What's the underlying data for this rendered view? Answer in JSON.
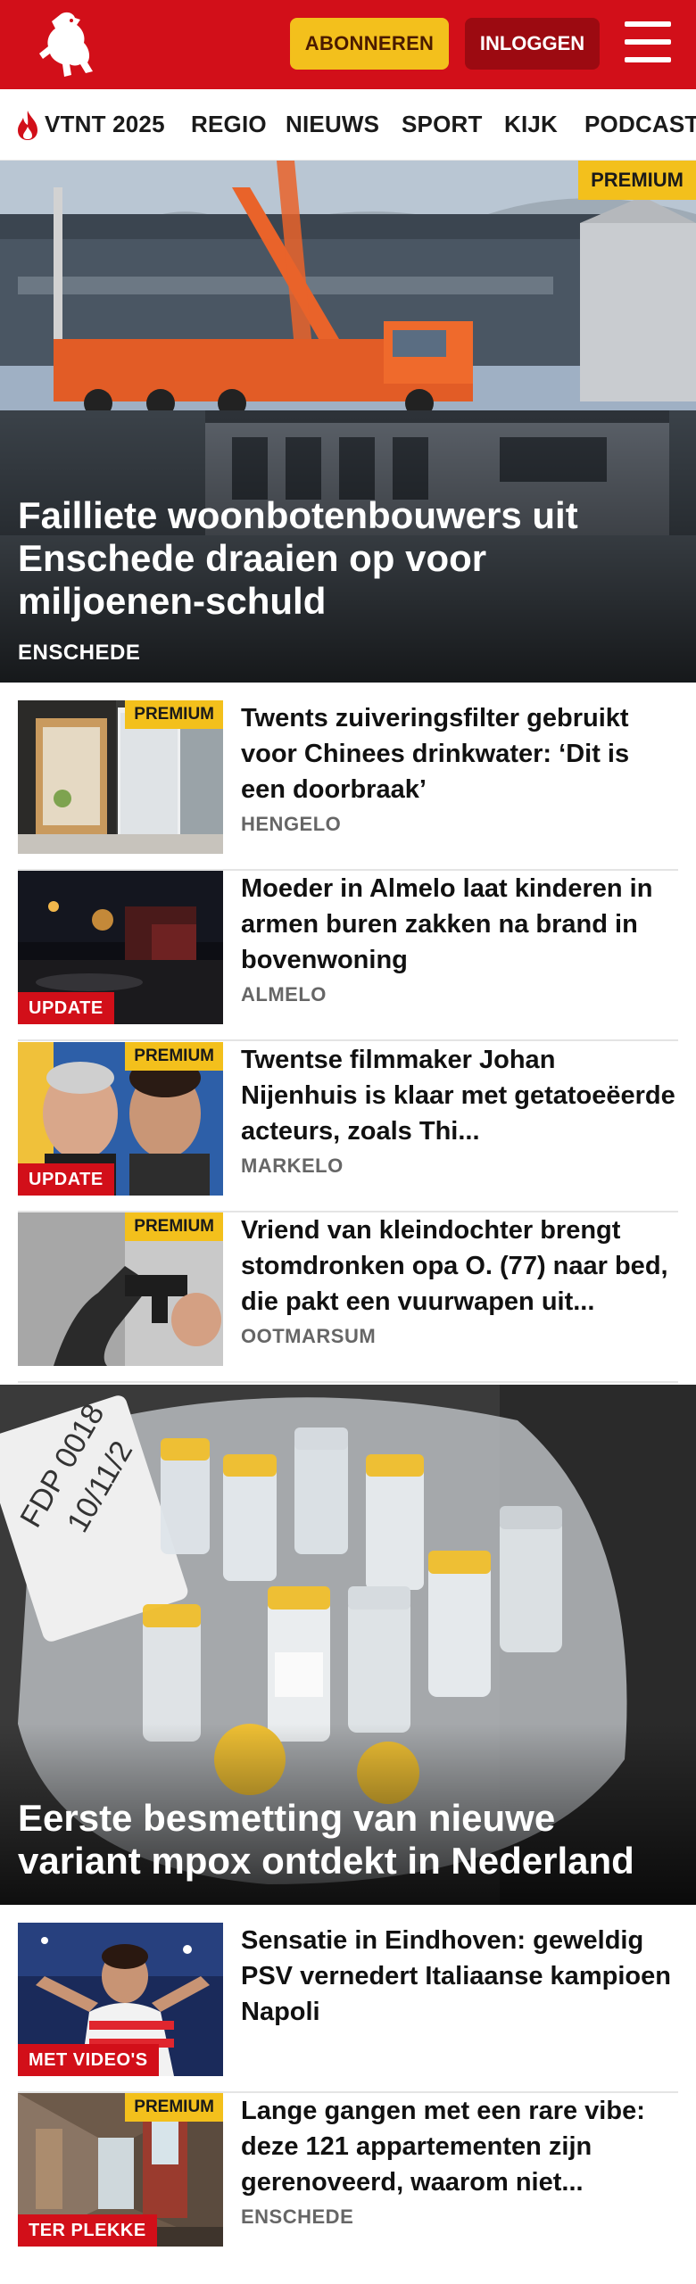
{
  "header": {
    "subscribe_label": "ABONNEREN",
    "login_label": "INLOGGEN",
    "brand_color": "#d20f19"
  },
  "nav": {
    "items": [
      {
        "label": "VTNT 2025",
        "icon": "flame-icon"
      },
      {
        "label": "REGIO"
      },
      {
        "label": "NIEUWS"
      },
      {
        "label": "SPORT"
      },
      {
        "label": "KIJK"
      },
      {
        "label": "PODCAST"
      }
    ]
  },
  "hero": {
    "badge": "PREMIUM",
    "title": "Failliete woonbotenbouwers uit Enschede draaien op voor miljoenen-schuld",
    "region": "ENSCHEDE"
  },
  "articles": [
    {
      "title": "Twents zuiveringsfilter gebruikt voor Chinees drinkwater: ‘Dit is een doorbraak’",
      "region": "HENGELO",
      "badge": "PREMIUM",
      "label": ""
    },
    {
      "title": "Moeder in Almelo laat kinderen in armen buren zakken na brand in bovenwoning",
      "region": "ALMELO",
      "badge": "",
      "label": "UPDATE"
    },
    {
      "title": "Twentse filmmaker Johan Nijenhuis is klaar met getatoeëerde acteurs, zoals Thi...",
      "region": "MARKELO",
      "badge": "PREMIUM",
      "label": "UPDATE"
    },
    {
      "title": "Vriend van kleindochter brengt stomdronken opa O. (77) naar bed, die pakt een vuurwapen uit...",
      "region": "OOTMARSUM",
      "badge": "PREMIUM",
      "label": ""
    }
  ],
  "hero2": {
    "title": "Eerste besmetting van nieuwe variant mpox ontdekt in Nederland",
    "vial_label_line1": "FDP 0018",
    "vial_label_line2": "10/11/2"
  },
  "articles2": [
    {
      "title": "Sensatie in Eindhoven: geweldig PSV vernedert Italiaanse kampioen Napoli",
      "region": "",
      "badge": "",
      "label": "MET VIDEO'S"
    },
    {
      "title": "Lange gangen met een rare vibe: deze 121 appartementen zijn gerenoveerd, waarom niet...",
      "region": "ENSCHEDE",
      "badge": "PREMIUM",
      "label": "TER PLEKKE"
    }
  ]
}
